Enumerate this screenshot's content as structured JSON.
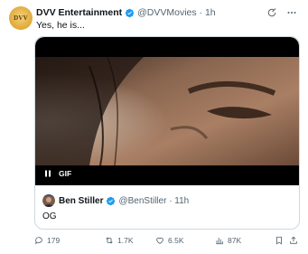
{
  "tweet": {
    "avatar_text": "DVV",
    "author_name": "DVV Entertainment",
    "handle_time": "@DVVMovies · 1h",
    "text": "Yes, he is...",
    "media_badge": "GIF"
  },
  "quoted": {
    "author_name": "Ben Stiller",
    "handle_time": "@BenStiller · 11h",
    "text": "OG"
  },
  "actions": {
    "replies": "179",
    "reposts": "1.7K",
    "likes": "6.5K",
    "views": "87K"
  },
  "colors": {
    "text": "#0f1419",
    "muted": "#536471",
    "verified_blue": "#1d9bf0",
    "border": "#cfd9de"
  },
  "icons": [
    "grok-icon",
    "more-icon",
    "verified-icon",
    "pause-icon",
    "reply-icon",
    "repost-icon",
    "like-icon",
    "views-icon",
    "bookmark-icon",
    "share-icon"
  ]
}
